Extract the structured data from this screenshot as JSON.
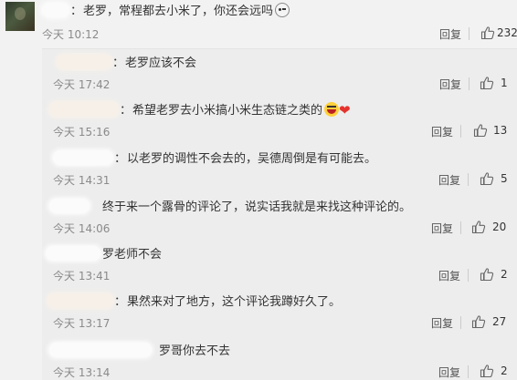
{
  "main_comment": {
    "name_blurred": "",
    "separator": "：",
    "text": "老罗，常程都去小米了，你还会远吗",
    "time": "今天 10:12",
    "reply_label": "回复",
    "like_count": "232"
  },
  "replies": [
    {
      "text": "老罗应该不会",
      "time": "今天 17:42",
      "reply_label": "回复",
      "like_count": "1"
    },
    {
      "text": "希望老罗去小米搞小米生态链之类的",
      "time": "今天 15:16",
      "reply_label": "回复",
      "like_count": "13"
    },
    {
      "text": "以老罗的调性不会去的，吴德周倒是有可能去。",
      "time": "今天 14:31",
      "reply_label": "回复",
      "like_count": "5"
    },
    {
      "text": "终于来一个露骨的评论了，说实话我就是来找这种评论的。",
      "time": "今天 14:06",
      "reply_label": "回复",
      "like_count": "20"
    },
    {
      "text": "罗老师不会",
      "time": "今天 13:41",
      "reply_label": "回复",
      "like_count": "2"
    },
    {
      "text": "果然来对了地方，这个评论我蹲好久了。",
      "time": "今天 13:17",
      "reply_label": "回复",
      "like_count": "27"
    },
    {
      "text": "罗哥你去不去",
      "time": "今天 13:14",
      "reply_label": "回复",
      "like_count": "2"
    }
  ],
  "colors": {
    "heart": "#e5322d",
    "emoji": "#ffd13b"
  },
  "icons": {
    "like": "thumbs-up-icon"
  }
}
